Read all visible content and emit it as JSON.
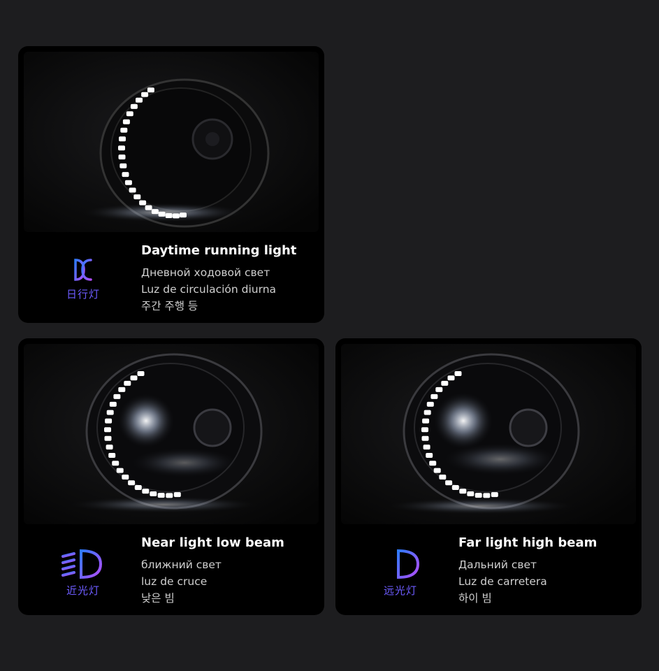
{
  "cards": [
    {
      "title": "Daytime running light",
      "lines": [
        "Дневной ходовой свет",
        "Luz de circulación diurna",
        "주간 주행 등"
      ],
      "icon": {
        "name": "daytime-running-light-icon",
        "label": "日行灯"
      }
    },
    {
      "title": "Near light low beam",
      "lines": [
        "ближний свет",
        "luz de cruce",
        "낮은 빔"
      ],
      "icon": {
        "name": "low-beam-icon",
        "label": "近光灯"
      }
    },
    {
      "title": "Far light high beam",
      "lines": [
        "Дальний свет",
        "Luz de carretera",
        "하이 빔"
      ],
      "icon": {
        "name": "high-beam-icon",
        "label": "远光灯"
      }
    }
  ],
  "colors": {
    "page_bg": "#1d1d1f",
    "card_bg": "#000000",
    "icon_gradient": [
      "#2f7bff",
      "#b44dff"
    ],
    "cjk_label": "#6d5cff"
  }
}
